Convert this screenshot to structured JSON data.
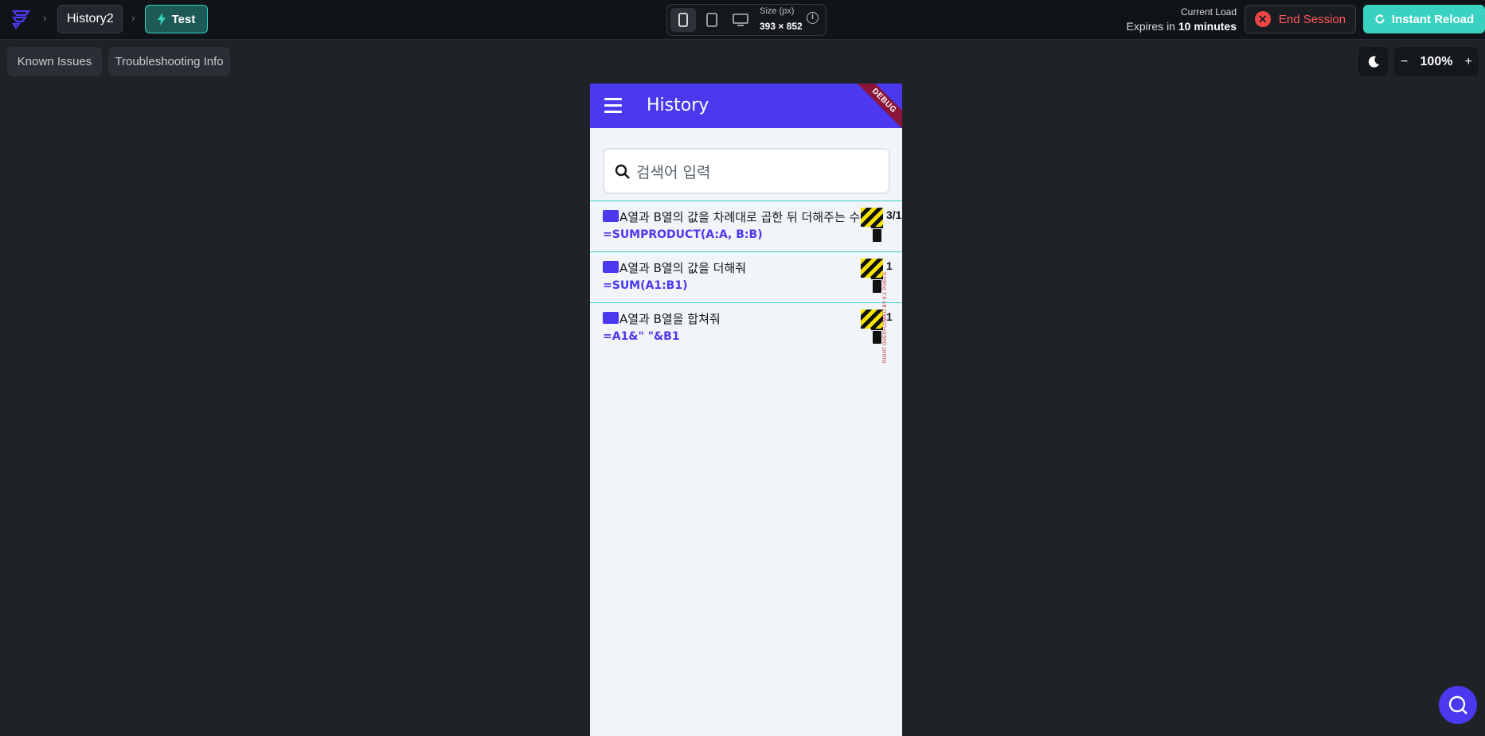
{
  "topbar": {
    "project_name": "History2",
    "test_label": "Test",
    "size_label": "Size (px)",
    "size_value": "393 × 852",
    "load_label": "Current Load",
    "expires_prefix": "Expires in",
    "expires_value": "10 minutes",
    "end_session_label": "End Session",
    "instant_reload_label": "Instant Reload"
  },
  "toolbar": {
    "known_issues_label": "Known Issues",
    "troubleshooting_label": "Troubleshooting Info",
    "zoom_value": "100%"
  },
  "app": {
    "title": "History",
    "debug_label": "DEBUG",
    "search_placeholder": "검색어 입력",
    "overflow_warning": "RIGHT OVERFLOWED BY 8.1 PIXELS",
    "items": [
      {
        "question": "A열과 B열의 값을 차례대로 곱한 뒤 더해주는 수",
        "formula": "=SUMPRODUCT(A:A, B:B)",
        "date": "3/1"
      },
      {
        "question": "A열과 B열의 값을 더해줘",
        "formula": "=SUM(A1:B1)",
        "date": "1"
      },
      {
        "question": "A열과 B열을 합쳐줘",
        "formula": "=A1&\" \"&B1",
        "date": "1"
      }
    ]
  },
  "colors": {
    "primary": "#4b39ef",
    "accent": "#39d2c0",
    "danger": "#ef4444",
    "background": "#1f2328"
  }
}
